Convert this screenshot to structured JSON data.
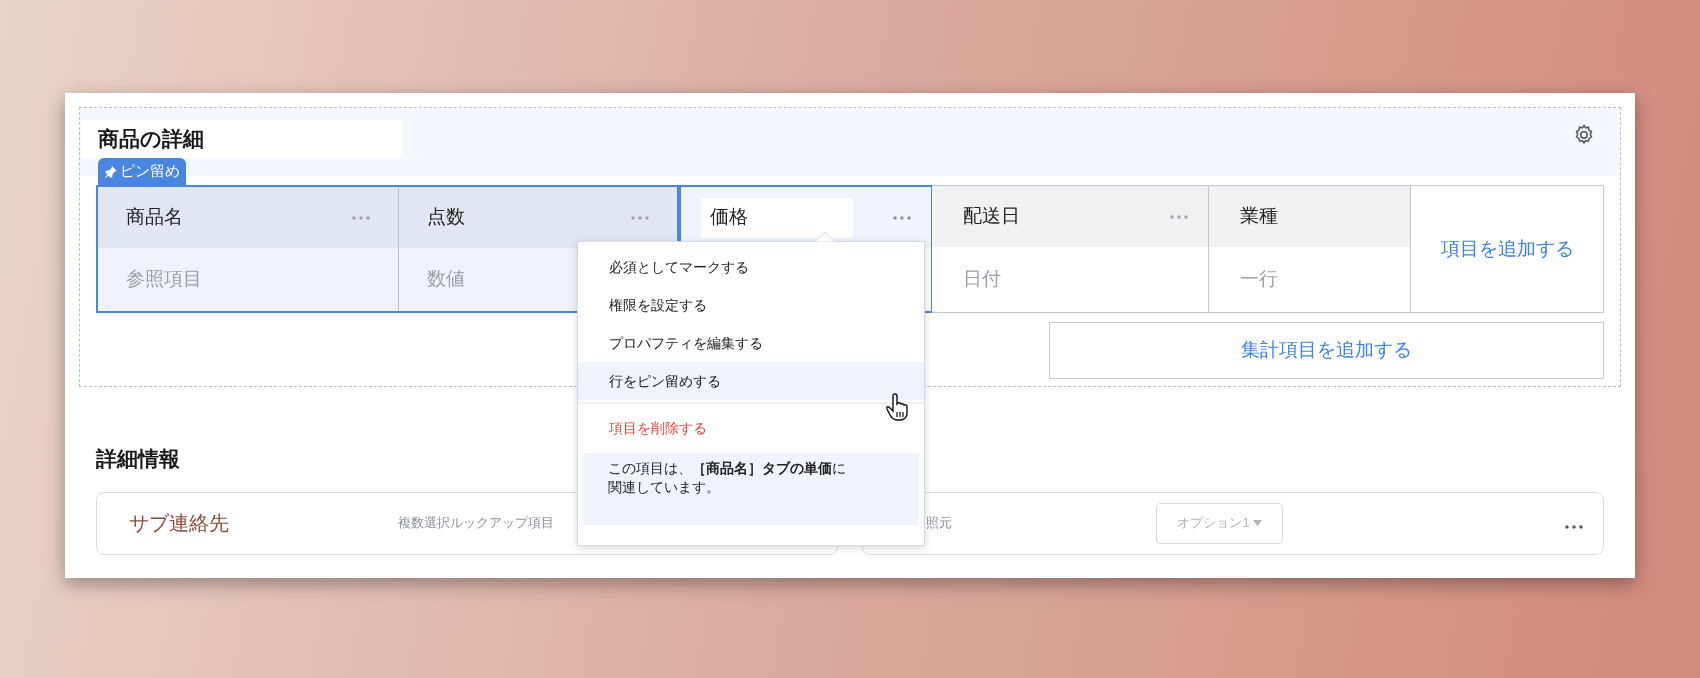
{
  "section": {
    "title": "商品の詳細",
    "pin_badge": "ピン留め",
    "add_column": "項目を追加する",
    "add_summary": "集計項目を追加する",
    "columns": [
      {
        "name": "商品名",
        "type": "参照項目",
        "pinned": true,
        "selected": false,
        "menu": true
      },
      {
        "name": "点数",
        "type": "数値",
        "pinned": true,
        "selected": false,
        "menu": true
      },
      {
        "name": "価格",
        "pinned": false,
        "selected": true,
        "menu": true
      },
      {
        "name": "配送日",
        "type": "日付",
        "pinned": false,
        "selected": false,
        "menu": true
      },
      {
        "name": "業種",
        "type": "一行",
        "pinned": false,
        "selected": false,
        "menu": false
      }
    ]
  },
  "context_menu": {
    "items": [
      {
        "label": "必須としてマークする",
        "kind": "action",
        "selected": false
      },
      {
        "label": "権限を設定する",
        "kind": "action",
        "selected": false
      },
      {
        "label": "プロパフティを編集する",
        "kind": "action",
        "selected": false
      },
      {
        "label": "行をピン留めする",
        "kind": "action",
        "selected": true
      },
      {
        "label": "項目を削除する",
        "kind": "danger",
        "selected": false
      }
    ],
    "note": "この項目は、**［商品名］タブの単価**に関連しています。"
  },
  "details": {
    "title": "詳細情報",
    "cards": [
      {
        "label": "サブ連絡先",
        "hint": "複数選択ルックアップ項目"
      },
      {
        "hint": "照元",
        "dropdown": "オプション1"
      }
    ]
  }
}
